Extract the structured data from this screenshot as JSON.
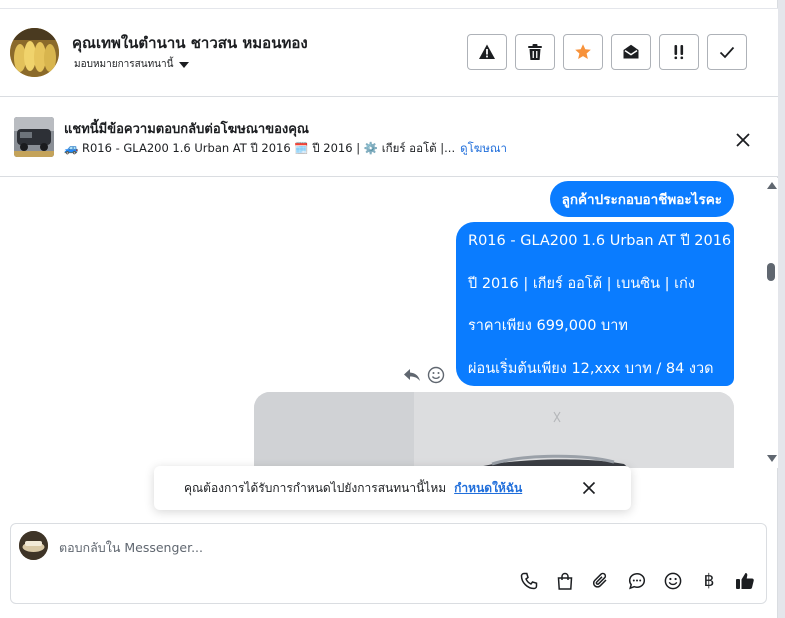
{
  "header": {
    "contact_name": "คุณเทพในตำนาน ชาวสน หมอนทอง",
    "assign_label": "มอบหมายการสนทนานี้",
    "actions": [
      {
        "name": "spam-button",
        "icon": "warning-icon"
      },
      {
        "name": "delete-button",
        "icon": "trash-icon"
      },
      {
        "name": "star-button",
        "icon": "star-icon",
        "color": "#f7923b"
      },
      {
        "name": "mark-unread-button",
        "icon": "open-envelope-icon"
      },
      {
        "name": "follow-up-button",
        "icon": "double-exclamation-icon"
      },
      {
        "name": "mark-done-button",
        "icon": "check-icon"
      }
    ]
  },
  "ad_banner": {
    "title": "แชทนี้มีข้อความตอบกลับต่อโฆษณาของคุณ",
    "subtitle": "🚙 R016 - GLA200 1.6 Urban AT ปี 2016 🗓️ ปี 2016 | ⚙️ เกียร์ ออโต้ |...",
    "link": "ดูโฆษณา"
  },
  "messages": {
    "short": "ลูกค้าประกอบอาชีพอะไรคะ",
    "long_lines": [
      "R016 - GLA200 1.6 Urban AT ปี 2016",
      "ปี 2016 |  เกียร์ ออโต้ | เบนซิน |  เก่ง",
      "ราคาเพียง 699,000 บาท",
      "ผ่อนเริ่มต้นเพียง 12,xxx บาท / 84 งวด"
    ],
    "bubble_color": "#0a7cff"
  },
  "toast": {
    "text": "คุณต้องการได้รับการกำหนดไปยังการสนทนานี้ไหม",
    "link": "กำหนดให้ฉัน"
  },
  "composer": {
    "placeholder": "ตอบกลับใน Messenger...",
    "tools": [
      "phone-icon",
      "shopping-bag-icon",
      "paperclip-icon",
      "chat-bubble-icon",
      "emoji-icon",
      "baht-icon",
      "thumbs-up-icon"
    ],
    "baht_symbol": "฿"
  }
}
